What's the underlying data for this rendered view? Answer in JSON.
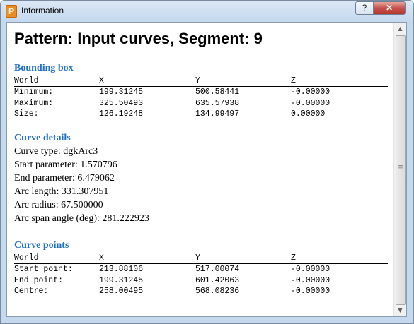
{
  "window": {
    "title": "Information",
    "app_icon_letter": "P",
    "help_label": "?",
    "close_label": "✕"
  },
  "report": {
    "heading": "Pattern: Input curves, Segment: 9",
    "bounding_box": {
      "title": "Bounding box",
      "columns": [
        "World",
        "X",
        "Y",
        "Z"
      ],
      "rows": [
        {
          "label": "Minimum:",
          "x": "199.31245",
          "y": "500.58441",
          "z": "-0.00000"
        },
        {
          "label": "Maximum:",
          "x": "325.50493",
          "y": "635.57938",
          "z": "-0.00000"
        },
        {
          "label": "Size:",
          "x": "126.19248",
          "y": "134.99497",
          "z": "0.00000"
        }
      ]
    },
    "curve_details": {
      "title": "Curve details",
      "lines": [
        "Curve type: dgkArc3",
        "Start parameter: 1.570796",
        "End parameter: 6.479062",
        "Arc length: 331.307951",
        "Arc radius: 67.500000",
        "Arc span angle (deg): 281.222923"
      ]
    },
    "curve_points": {
      "title": "Curve points",
      "columns": [
        "World",
        "X",
        "Y",
        "Z"
      ],
      "rows": [
        {
          "label": "Start point:",
          "x": "213.88106",
          "y": "517.00074",
          "z": "-0.00000"
        },
        {
          "label": "End point:",
          "x": "199.31245",
          "y": "601.42063",
          "z": "-0.00000"
        },
        {
          "label": "Centre:",
          "x": "258.00495",
          "y": "568.08236",
          "z": "-0.00000"
        }
      ]
    }
  },
  "scrollbar": {
    "up_icon": "up-arrow-icon",
    "down_icon": "down-arrow-icon"
  }
}
